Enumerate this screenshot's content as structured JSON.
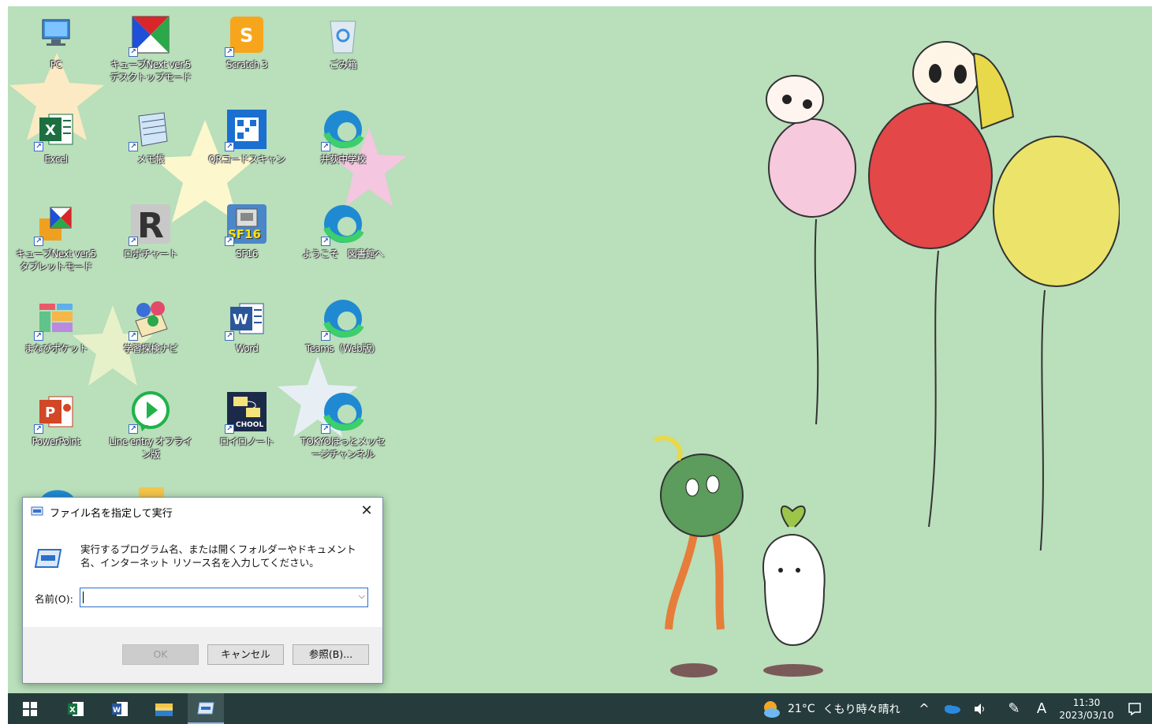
{
  "desktop": {
    "icons": [
      {
        "label": "PC"
      },
      {
        "label": "キューブNext ver.5 デスクトップモード"
      },
      {
        "label": "Scratch 3"
      },
      {
        "label": "ごみ箱"
      },
      {
        "label": "Excel"
      },
      {
        "label": "メモ帳"
      },
      {
        "label": "QRコードスキャン"
      },
      {
        "label": "井荻中学校"
      },
      {
        "label": "キューブNext ver.5 タブレットモード"
      },
      {
        "label": "ロボチャート"
      },
      {
        "label": "SF16"
      },
      {
        "label": "ようこそ　図書館へ"
      },
      {
        "label": "まなびポケット"
      },
      {
        "label": "学習探検ナビ"
      },
      {
        "label": "Word"
      },
      {
        "label": "Teams（Web版）"
      },
      {
        "label": "PowerPoint"
      },
      {
        "label": "Line entry オフライン版"
      },
      {
        "label": "ロイロノート"
      },
      {
        "label": "TOKYOほっとメッセージチャンネル"
      }
    ],
    "sf16_badge": "SF16",
    "schoolt_badge": "CHOOL"
  },
  "run_dialog": {
    "title": "ファイル名を指定して実行",
    "description": "実行するプログラム名、または開くフォルダーやドキュメント名、インターネット リソース名を入力してください。",
    "name_label": "名前(O):",
    "name_value": "",
    "ok": "OK",
    "cancel": "キャンセル",
    "browse": "参照(B)..."
  },
  "taskbar": {
    "weather_temp": "21°C",
    "weather_desc": "くもり時々晴れ",
    "ime": "A",
    "time": "11:30",
    "date": "2023/03/10"
  },
  "colors": {
    "desktop_bg": "#b9dfbb",
    "taskbar_bg": "#263c3c",
    "accent": "#2a6fc9"
  }
}
